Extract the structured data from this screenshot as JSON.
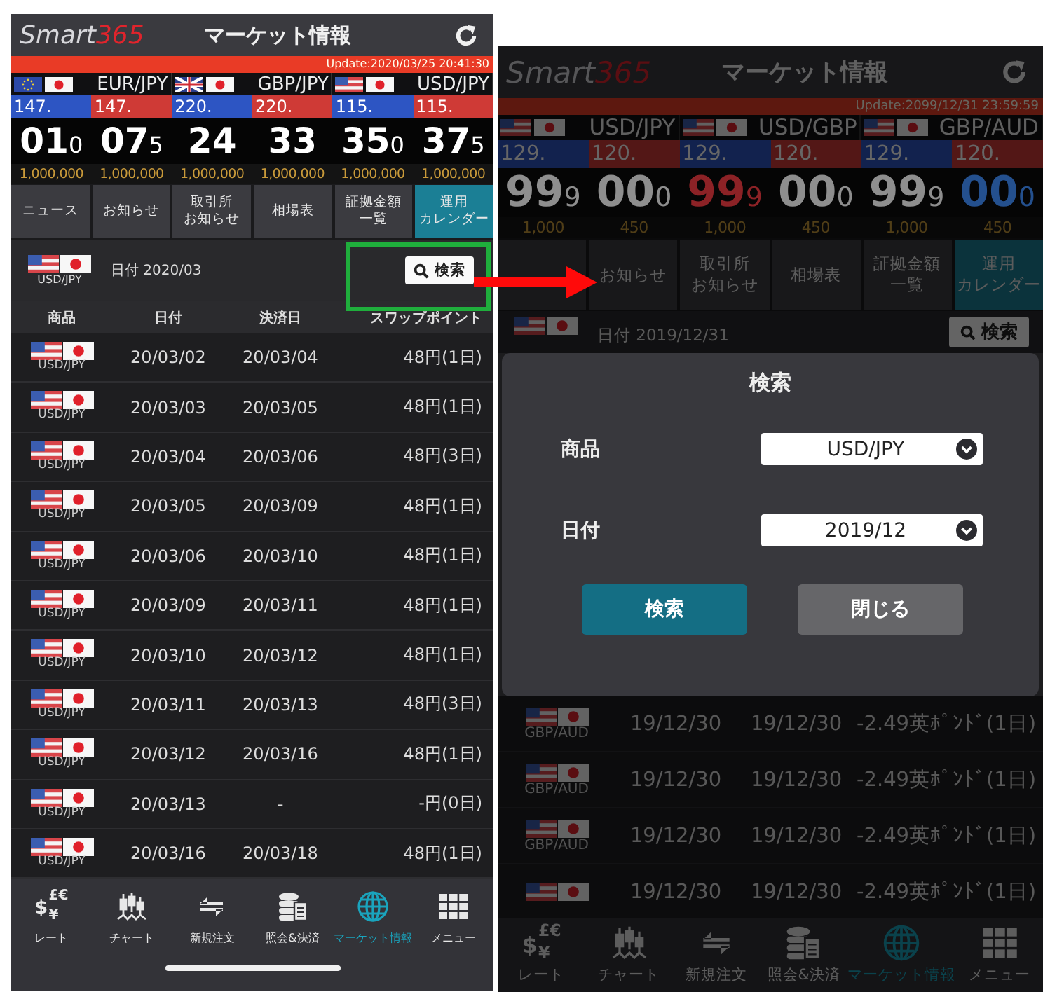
{
  "screens": [
    {
      "dimmed": false,
      "header": {
        "logo_a": "Smart",
        "logo_b": "365",
        "title": "マーケット情報"
      },
      "update": "Update:2020/03/25 20:41:30",
      "pairs": [
        {
          "flags": [
            {
              "kind": "eu"
            },
            {
              "kind": "jp"
            }
          ],
          "name": "EUR/JPY",
          "bid": {
            "big": "147.",
            "main": "01",
            "small": "0",
            "color": "#ffffff",
            "amount": "1,000,000"
          },
          "ask": {
            "big": "147.",
            "main": "07",
            "small": "5",
            "color": "#ffffff",
            "amount": "1,000,000"
          }
        },
        {
          "flags": [
            {
              "kind": "gb"
            },
            {
              "kind": "jp"
            }
          ],
          "name": "GBP/JPY",
          "bid": {
            "big": "220.",
            "main": "24",
            "color": "#ffffff",
            "amount": "1,000,000"
          },
          "ask": {
            "big": "220.",
            "main": "33",
            "color": "#ffffff",
            "amount": "1,000,000"
          }
        },
        {
          "flags": [
            {
              "kind": "us"
            },
            {
              "kind": "jp"
            }
          ],
          "name": "USD/JPY",
          "bid": {
            "big": "115.",
            "main": "35",
            "small": "0",
            "color": "#ffffff",
            "amount": "1,000,000"
          },
          "ask": {
            "big": "115.",
            "main": "37",
            "small": "5",
            "color": "#ffffff",
            "amount": "1,000,000"
          }
        }
      ],
      "menu": [
        {
          "lines": [
            "ニュース"
          ],
          "selected": false
        },
        {
          "lines": [
            "お知らせ"
          ],
          "selected": false
        },
        {
          "lines": [
            "取引所",
            "お知らせ"
          ],
          "selected": false
        },
        {
          "lines": [
            "相場表"
          ],
          "selected": false
        },
        {
          "lines": [
            "証拠金額",
            "一覧"
          ],
          "selected": false
        },
        {
          "lines": [
            "運用",
            "カレンダー"
          ],
          "selected": true
        }
      ],
      "filter": {
        "flags": [
          {
            "kind": "us"
          },
          {
            "kind": "jp"
          }
        ],
        "pair": "USD/JPY",
        "date": "日付 2020/03",
        "search": "検索"
      },
      "columns": [
        "商品",
        "日付",
        "決済日",
        "スワップポイント"
      ],
      "rows": [
        {
          "flags": [
            {
              "kind": "us"
            },
            {
              "kind": "jp"
            }
          ],
          "pair": "USD/JPY",
          "date": "20/03/02",
          "settle": "20/03/04",
          "swap": "48円(1日)"
        },
        {
          "flags": [
            {
              "kind": "us"
            },
            {
              "kind": "jp"
            }
          ],
          "pair": "USD/JPY",
          "date": "20/03/03",
          "settle": "20/03/05",
          "swap": "48円(1日)"
        },
        {
          "flags": [
            {
              "kind": "us"
            },
            {
              "kind": "jp"
            }
          ],
          "pair": "USD/JPY",
          "date": "20/03/04",
          "settle": "20/03/06",
          "swap": "48円(3日)"
        },
        {
          "flags": [
            {
              "kind": "us"
            },
            {
              "kind": "jp"
            }
          ],
          "pair": "USD/JPY",
          "date": "20/03/05",
          "settle": "20/03/09",
          "swap": "48円(1日)"
        },
        {
          "flags": [
            {
              "kind": "us"
            },
            {
              "kind": "jp"
            }
          ],
          "pair": "USD/JPY",
          "date": "20/03/06",
          "settle": "20/03/10",
          "swap": "48円(1日)"
        },
        {
          "flags": [
            {
              "kind": "us"
            },
            {
              "kind": "jp"
            }
          ],
          "pair": "USD/JPY",
          "date": "20/03/09",
          "settle": "20/03/11",
          "swap": "48円(1日)"
        },
        {
          "flags": [
            {
              "kind": "us"
            },
            {
              "kind": "jp"
            }
          ],
          "pair": "USD/JPY",
          "date": "20/03/10",
          "settle": "20/03/12",
          "swap": "48円(1日)"
        },
        {
          "flags": [
            {
              "kind": "us"
            },
            {
              "kind": "jp"
            }
          ],
          "pair": "USD/JPY",
          "date": "20/03/11",
          "settle": "20/03/13",
          "swap": "48円(3日)"
        },
        {
          "flags": [
            {
              "kind": "us"
            },
            {
              "kind": "jp"
            }
          ],
          "pair": "USD/JPY",
          "date": "20/03/12",
          "settle": "20/03/16",
          "swap": "48円(1日)"
        },
        {
          "flags": [
            {
              "kind": "us"
            },
            {
              "kind": "jp"
            }
          ],
          "pair": "USD/JPY",
          "date": "20/03/13",
          "settle": "-",
          "swap": "-円(0日)"
        },
        {
          "flags": [
            {
              "kind": "us"
            },
            {
              "kind": "jp"
            }
          ],
          "pair": "USD/JPY",
          "date": "20/03/16",
          "settle": "20/03/18",
          "swap": "48円(1日)"
        }
      ],
      "nav": [
        {
          "kind": "currency",
          "symbols": [
            "$",
            "£€",
            "¥"
          ],
          "label": "レート",
          "selected": false
        },
        {
          "kind": "candles",
          "label": "チャート",
          "selected": false
        },
        {
          "kind": "swap",
          "label": "新規注文",
          "selected": false
        },
        {
          "kind": "coins",
          "label": "照会&決済",
          "selected": false
        },
        {
          "kind": "globe",
          "label": "マーケット情報",
          "selected": true
        },
        {
          "kind": "grid",
          "label": "メニュー",
          "selected": false
        }
      ]
    },
    {
      "dimmed": true,
      "header": {
        "logo_a": "Smart",
        "logo_b": "365",
        "title": "マーケット情報"
      },
      "update": "Update:2099/12/31 23:59:59",
      "pairs": [
        {
          "flags": [
            {
              "kind": "us"
            },
            {
              "kind": "jp"
            }
          ],
          "name": "USD/JPY",
          "bid": {
            "big": "129.",
            "main": "99",
            "small": "9",
            "color": "#8e8e8e",
            "amount": "1,000"
          },
          "ask": {
            "big": "120.",
            "main": "00",
            "small": "0",
            "color": "#8e8e8e",
            "amount": "450"
          }
        },
        {
          "flags": [
            {
              "kind": "us"
            },
            {
              "kind": "jp"
            }
          ],
          "name": "USD/GBP",
          "bid": {
            "big": "129.",
            "main": "99",
            "small": "9",
            "color": "#8c2226",
            "amount": "1,000"
          },
          "ask": {
            "big": "120.",
            "main": "00",
            "small": "0",
            "color": "#8e8e8e",
            "amount": "450"
          }
        },
        {
          "flags": [
            {
              "kind": "us"
            },
            {
              "kind": "jp"
            }
          ],
          "name": "GBP/AUD",
          "bid": {
            "big": "129.",
            "main": "99",
            "small": "9",
            "color": "#8e8e8e",
            "amount": "1,000"
          },
          "ask": {
            "big": "120.",
            "main": "00",
            "small": "0",
            "color": "#24508e",
            "amount": "450"
          }
        }
      ],
      "menu": [
        {
          "selected": false
        },
        {
          "lines": [
            "お知らせ"
          ],
          "selected": false
        },
        {
          "lines": [
            "取引所",
            "お知らせ"
          ],
          "selected": false
        },
        {
          "lines": [
            "相場表"
          ],
          "selected": false
        },
        {
          "lines": [
            "証拠金額",
            "一覧"
          ],
          "selected": false
        },
        {
          "lines": [
            "運用",
            "カレンダー"
          ],
          "selected": true
        }
      ],
      "filter": {
        "flags": [
          {
            "kind": "us"
          },
          {
            "kind": "jp"
          }
        ],
        "date": "日付 2019/12/31",
        "search": "検索"
      },
      "dialog": {
        "title": "検索",
        "fields": [
          {
            "label": "商品",
            "value": "USD/JPY"
          },
          {
            "label": "日付",
            "value": "2019/12"
          }
        ],
        "buttons": [
          {
            "label": "検索",
            "kind": "primary"
          },
          {
            "label": "閉じる",
            "kind": "secondary"
          }
        ]
      },
      "rows": [
        {
          "flags": [
            {
              "kind": "us"
            },
            {
              "kind": "jp"
            }
          ],
          "pair": "GBP/AUD",
          "date": "19/12/30",
          "settle": "19/12/30",
          "swap": "-2.49英ﾎﾟﾝﾄﾞ(1日)"
        },
        {
          "flags": [
            {
              "kind": "us"
            },
            {
              "kind": "jp"
            }
          ],
          "pair": "GBP/AUD",
          "date": "19/12/30",
          "settle": "19/12/30",
          "swap": "-2.49英ﾎﾟﾝﾄﾞ(1日)"
        },
        {
          "flags": [
            {
              "kind": "us"
            },
            {
              "kind": "jp"
            }
          ],
          "pair": "GBP/AUD",
          "date": "19/12/30",
          "settle": "19/12/30",
          "swap": "-2.49英ﾎﾟﾝﾄﾞ(1日)"
        },
        {
          "flags": [
            {
              "kind": "us"
            },
            {
              "kind": "jp"
            }
          ],
          "date": "19/12/30",
          "settle": "19/12/30",
          "swap": "-2.49英ﾎﾟﾝﾄﾞ(1日)"
        }
      ],
      "nav": [
        {
          "kind": "currency",
          "symbols": [
            "$",
            "£€",
            "¥"
          ],
          "label": "レート",
          "selected": false
        },
        {
          "kind": "candles",
          "label": "チャート",
          "selected": false
        },
        {
          "kind": "swap",
          "label": "新規注文",
          "selected": false
        },
        {
          "kind": "coins",
          "label": "照会&決済",
          "selected": false
        },
        {
          "kind": "globe",
          "label": "マーケット情報",
          "selected": true
        },
        {
          "kind": "grid",
          "label": "メニュー",
          "selected": false
        }
      ]
    }
  ],
  "annotations": [
    {
      "kind": "box",
      "color": "#1fae3c"
    },
    {
      "kind": "arrow",
      "color": "#ff0a0a"
    }
  ]
}
